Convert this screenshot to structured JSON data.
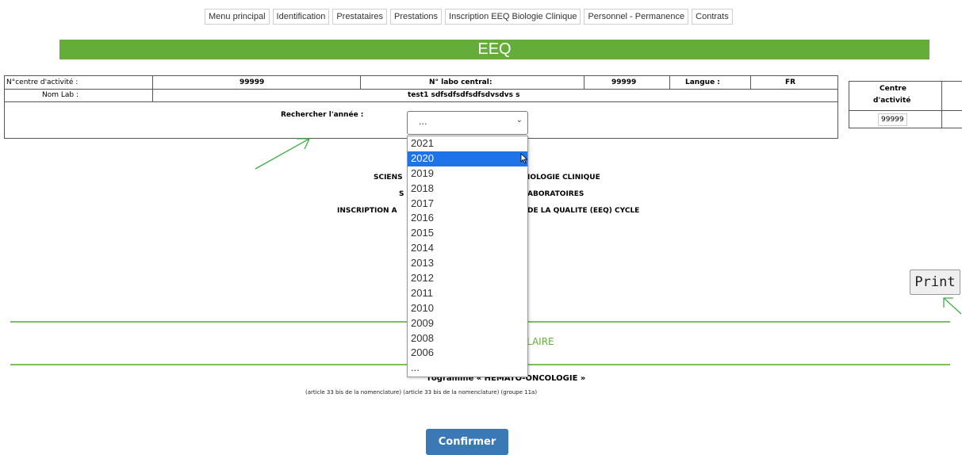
{
  "nav": {
    "items": [
      "Menu principal",
      "Identification",
      "Prestataires",
      "Prestations",
      "Inscription EEQ Biologie Clinique",
      "Personnel - Permanence",
      "Contrats"
    ]
  },
  "banner": {
    "title": "EEQ"
  },
  "info": {
    "centre_label": "N°centre d'activité :",
    "centre_value": "99999",
    "labo_label": "N° labo central:",
    "labo_value": "99999",
    "langue_label": "Langue :",
    "langue_value": "FR",
    "nomlab_label": "Nom Lab :",
    "nomlab_value": "test1 sdfsdfsdfsdfsdvsdvs s",
    "search_label": "Rechercher l'année :"
  },
  "side": {
    "header_line1": "Centre",
    "header_line2": "d'activité",
    "value": "99999"
  },
  "year_select": {
    "selected": "...",
    "options": [
      "2021",
      "2020",
      "2019",
      "2018",
      "2017",
      "2016",
      "2015",
      "2014",
      "2013",
      "2012",
      "2011",
      "2010",
      "2009",
      "2008",
      "2006",
      "..."
    ],
    "highlighted": "2020"
  },
  "body_text": {
    "line1_left": "SCIENS",
    "line1_right": "IOLOGIE CLINIQUE",
    "line2_left": "S",
    "line2_right": "ABORATOIRES",
    "line3_left": "INSCRIPTION A",
    "line3_right": "DE LA QUALITE (EEQ) CYCLE"
  },
  "section": {
    "title_partial": "LAIRE",
    "programme": "Programme «  HEMATO-ONCOLOGIE »",
    "programme_visible": "rogramme «  HEMATO-ONCOLOGIE »",
    "article_note": "(article 33 bis de la nomenclature) (article 33 bis de la nomenclature) (groupe 11a)"
  },
  "buttons": {
    "print": "Print",
    "confirm": "Confirmer"
  },
  "colors": {
    "banner_green": "#64ad3b",
    "line_green": "#7cc15b",
    "section_title_green": "#64ad3b",
    "select_highlight": "#1e73e8",
    "confirm_blue": "#3a79b6",
    "arrow_green": "#3cb043"
  }
}
